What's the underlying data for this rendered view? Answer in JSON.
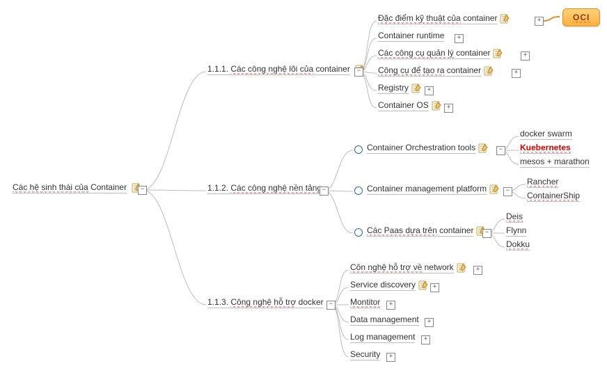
{
  "root": {
    "label_plain": "Các hệ sinh thái của Container",
    "label_spell": "Các hệ sinh thái của"
  },
  "sec1": {
    "num": "1.1.1.",
    "label": "Các công nghệ lõi của container",
    "label_spell": "Các công nghệ lõi của"
  },
  "sec2": {
    "num": "1.1.2.",
    "label": "Các công nghệ nền tảng",
    "label_spell": "Các công nghệ nền tảng"
  },
  "sec3": {
    "num": "1.1.3.",
    "label": "Công nghệ hỗ trợ  docker",
    "label_spell": "Công nghệ hỗ trợ"
  },
  "s1": {
    "a": {
      "t_spell": "Đặc điểm kỹ thuật của",
      "t_tail": " container"
    },
    "b": {
      "t": "Container runtime"
    },
    "c": {
      "t_spell": "Các công cụ quản lý",
      "t_tail": " container"
    },
    "d": {
      "t_spell": "Công cụ để tạo ra",
      "t_tail": " container"
    },
    "e": {
      "t": "Registry"
    },
    "f": {
      "t": "Container OS"
    }
  },
  "s2": {
    "a": {
      "t": "Container Orchestration tools"
    },
    "b": {
      "t": "Container management platform"
    },
    "c": {
      "t_spell": "Các Paas dựa trên",
      "t_tail": " container"
    }
  },
  "s2a": {
    "1": "docker swarm",
    "2": "Kuebernetes",
    "3": "mesos + marathon"
  },
  "s2b": {
    "1": "Rancher",
    "2": "ContainerShip"
  },
  "s2c": {
    "1": "Deis",
    "2": "Flynn",
    "3": "Dokku"
  },
  "s3": {
    "a": {
      "t_spell": "Côn nghệ hỗ trợ về",
      "t_tail": " network"
    },
    "b": {
      "t": "Service discovery"
    },
    "c": {
      "t_spell": "Montitor"
    },
    "d": {
      "t": "Data management"
    },
    "e": {
      "t": "Log management"
    },
    "f": {
      "t": "Security"
    }
  },
  "callout": "OCI",
  "glyph": {
    "plus": "+",
    "minus": "−"
  }
}
